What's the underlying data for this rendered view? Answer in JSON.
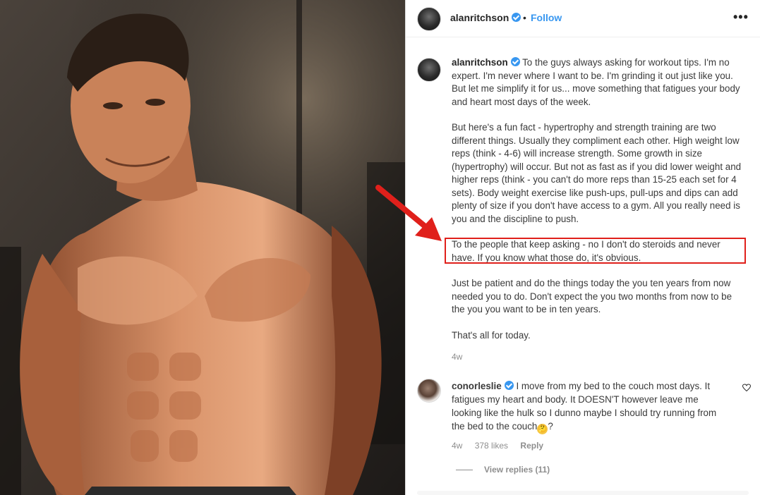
{
  "header": {
    "username": "alanritchson",
    "separator": "•",
    "follow_label": "Follow",
    "more_label": "•••"
  },
  "caption": {
    "username": "alanritchson",
    "intro": "To the guys always asking for workout tips. I'm no expert. I'm never where I want to be. I'm grinding it out just like you. But let me simplify it for us... move something that fatigues your body and heart most days of the week.",
    "paragraph_2": "But here's a fun fact - hypertrophy and strength training are two different things. Usually they compliment each other. High weight low reps (think - 4-6) will increase strength. Some growth in size (hypertrophy) will occur. But not as fast as if you did lower weight and higher reps (think - you can't do more reps than 15-25 each set for 4 sets). Body weight exercise like push-ups, pull-ups and dips can add plenty of size if you don't have access to a gym. All you really need is you and the discipline to push.",
    "paragraph_3": "To the people that keep asking - no I don't do steroids and never have. If you know what those do, it's obvious.",
    "paragraph_4": "Just be patient and do the things today the you ten years from now needed you to do. Don't expect the you two months from now to be the you you want to be in ten years.",
    "paragraph_5": "That's all for today.",
    "age": "4w"
  },
  "comment": {
    "username": "conorleslie",
    "text": "I move from my bed to the couch most days. It fatigues my heart and body. It DOESN'T however leave me looking like the hulk so I dunno maybe I should try running from the bed to the couch",
    "text_end": "?",
    "emoji": "🤔",
    "age": "4w",
    "likes": "378 likes",
    "reply_label": "Reply",
    "view_replies": "View replies (11)"
  },
  "annotations": {
    "arrow_color": "#e0201b",
    "box_color": "#e0201b"
  },
  "colors": {
    "link_blue": "#3897f0",
    "meta_gray": "#8e8e8e",
    "text": "#262626"
  },
  "icons": [
    "verified-badge-icon",
    "more-options-icon",
    "heart-icon",
    "red-arrow-icon"
  ]
}
